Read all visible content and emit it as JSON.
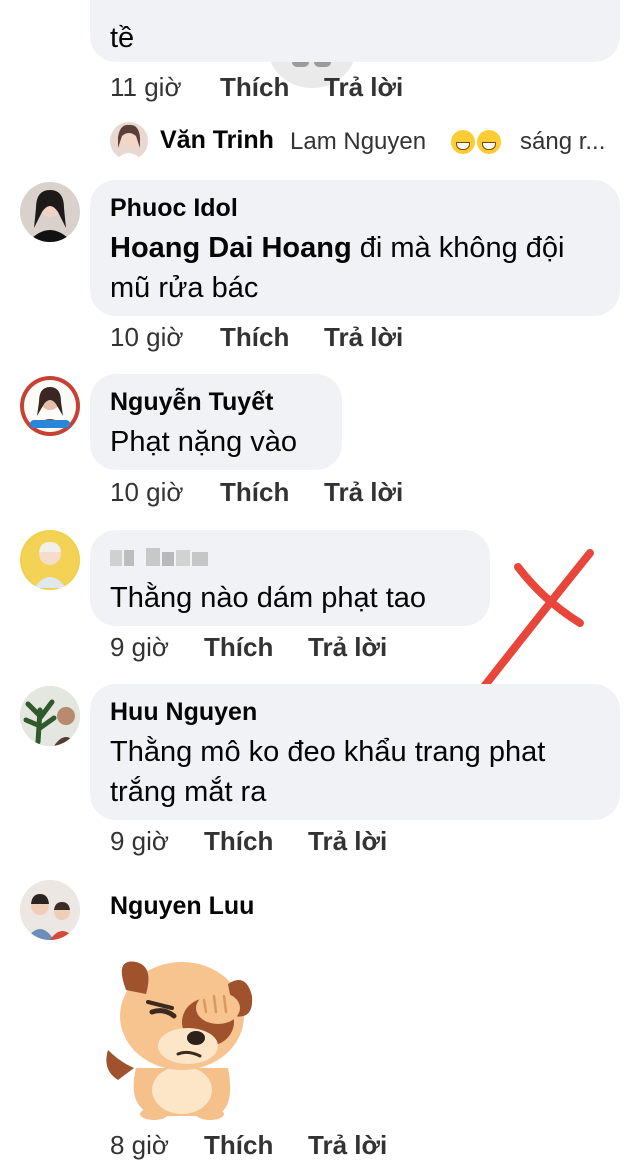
{
  "comments": [
    {
      "text": "tề",
      "time": "11 giờ",
      "like": "Thích",
      "reply": "Trả lời"
    },
    {
      "author": "Phuoc Idol",
      "mention": "Hoang Dai Hoang",
      "text": " đi mà không đội mũ rửa bác",
      "time": "10 giờ",
      "like": "Thích",
      "reply": "Trả lời"
    },
    {
      "author": "Nguyễn Tuyết",
      "text": "Phạt nặng vào",
      "time": "10 giờ",
      "like": "Thích",
      "reply": "Trả lời"
    },
    {
      "text": "Thằng nào dám phạt tao",
      "time": "9 giờ",
      "like": "Thích",
      "reply": "Trả lời"
    },
    {
      "author": "Huu Nguyen",
      "text": "Thằng mô ko đeo khẩu trang phat trắng mắt ra",
      "time": "9 giờ",
      "like": "Thích",
      "reply": "Trả lời"
    },
    {
      "author": "Nguyen Luu",
      "time": "8 giờ",
      "like": "Thích",
      "reply": "Trả lời"
    }
  ],
  "reply_preview": {
    "author": "Văn Trinh",
    "mention": "Lam Nguyen",
    "suffix": "sáng r..."
  },
  "colors": {
    "bubble": "#f0f2f5",
    "annotation_cross": "#e8463a"
  },
  "icons": [
    "grid-icon",
    "grinning-emoji-icon",
    "dog-sticker",
    "red-cross-annotation"
  ]
}
